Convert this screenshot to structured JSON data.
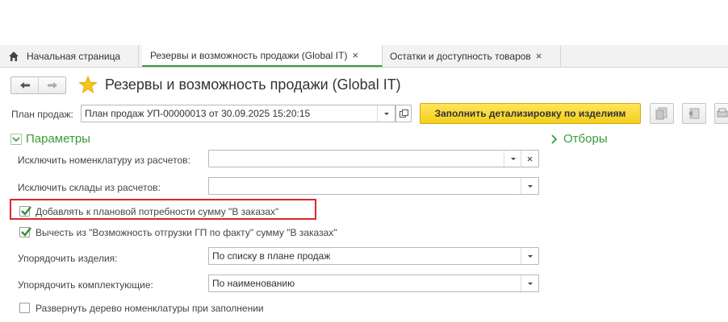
{
  "tabs": [
    {
      "label": "Начальная страница",
      "closable": false,
      "active": false,
      "icon": "home-icon"
    },
    {
      "label": "Резервы и возможность продажи (Global IT)",
      "closable": true,
      "active": true
    },
    {
      "label": "Остатки и доступность товаров",
      "closable": true,
      "active": false
    }
  ],
  "tab_close_glyph": "×",
  "header": {
    "title": "Резервы и возможность продажи (Global IT)",
    "favorite_icon": "star-icon",
    "back_icon": "arrow-left-icon",
    "forward_icon": "arrow-right-icon"
  },
  "plan": {
    "label": "План продаж:",
    "value": "План продаж УП-00000013 от 30.09.2025 15:20:15"
  },
  "toolbar": {
    "fill_button_label": "Заполнить детализировку по изделиям"
  },
  "parameters": {
    "section_label": "Параметры",
    "filters_label": "Отборы",
    "exclude_items_label": "Исключить номенклатуру из расчетов:",
    "exclude_items_value": "",
    "exclude_warehouses_label": "Исключить склады из расчетов:",
    "exclude_warehouses_value": "",
    "add_to_planned_label": "Добавлять к плановой потребности сумму \"В заказах\"",
    "add_to_planned_checked": true,
    "subtract_label": "Вычесть из \"Возможность отгрузки ГП по факту\" сумму \"В заказах\"",
    "subtract_checked": true,
    "sort_items_label": "Упорядочить изделия:",
    "sort_items_value": "По списку в плане продаж",
    "sort_components_label": "Упорядочить комплектующие:",
    "sort_components_value": "По наименованию",
    "expand_tree_label": "Развернуть дерево номенклатуры при заполнении",
    "expand_tree_checked": false
  },
  "colors": {
    "accent_green": "#3a9a3a",
    "button_yellow": "#f5cf1c",
    "highlight_red": "#d9262b"
  }
}
